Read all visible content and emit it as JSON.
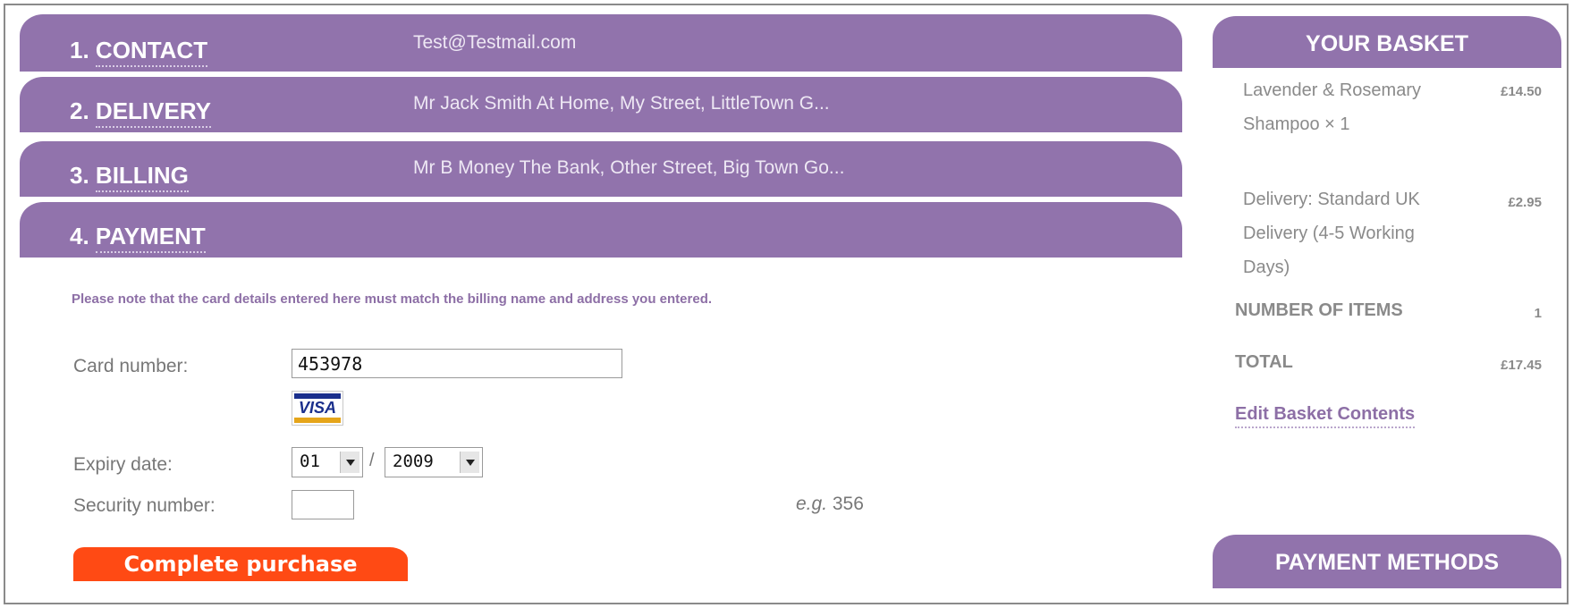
{
  "steps": [
    {
      "number": "1.",
      "label": "CONTACT",
      "summary": "Test@Testmail.com"
    },
    {
      "number": "2.",
      "label": "DELIVERY",
      "summary": "Mr Jack Smith At Home, My Street, LittleTown G..."
    },
    {
      "number": "3.",
      "label": "BILLING",
      "summary": "Mr B Money The Bank, Other Street, Big Town Go..."
    },
    {
      "number": "4.",
      "label": "PAYMENT",
      "summary": ""
    }
  ],
  "payment": {
    "note": "Please note that the card details entered here must match the billing name and address you entered.",
    "card_label": "Card number:",
    "card_value": "453978",
    "card_brand": "VISA",
    "expiry_label": "Expiry date:",
    "expiry_month": "01",
    "expiry_separator": "/",
    "expiry_year": "2009",
    "security_label": "Security number:",
    "security_value": "",
    "example_prefix": "e.g.",
    "example_value": "356",
    "submit_label": "Complete purchase"
  },
  "basket": {
    "title": "YOUR BASKET",
    "items": [
      {
        "name": "Lavender & Rosemary Shampoo × 1",
        "price": "£14.50"
      },
      {
        "name": "Delivery: Standard UK Delivery (4-5 Working Days)",
        "price": "£2.95"
      }
    ],
    "number_of_items_label": "NUMBER OF ITEMS",
    "number_of_items": "1",
    "total_label": "TOTAL",
    "total": "£17.45",
    "edit_link": "Edit Basket Contents",
    "payment_methods_title": "PAYMENT METHODS"
  },
  "colors": {
    "accent_purple": "#9173ac",
    "button_orange": "#ff4a14",
    "text_grey": "#777777"
  }
}
